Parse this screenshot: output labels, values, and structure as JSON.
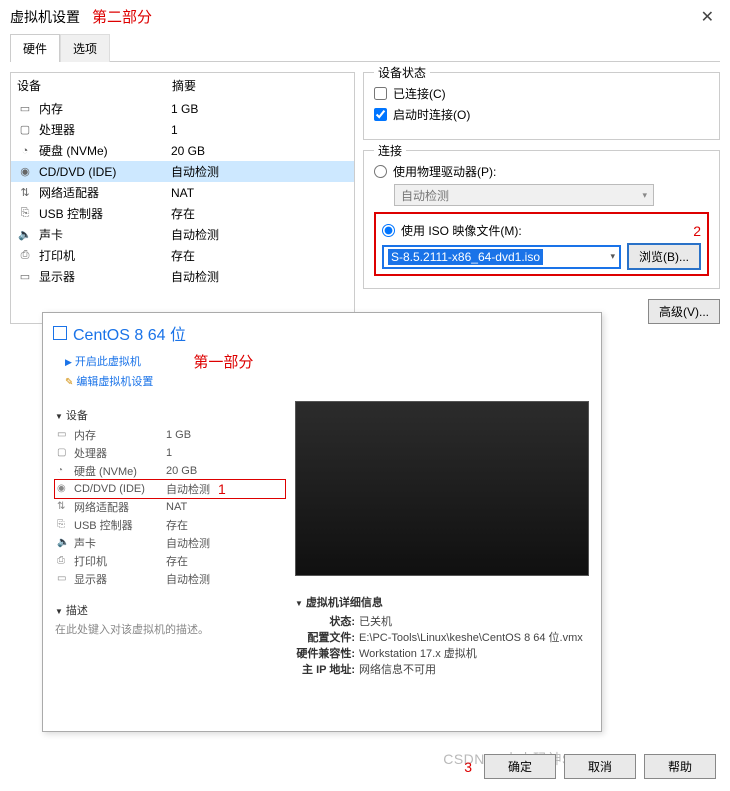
{
  "title": "虚拟机设置",
  "annotations": {
    "part2": "第二部分",
    "part1": "第一部分",
    "mark1": "1",
    "mark2": "2",
    "mark3": "3"
  },
  "close": "✕",
  "tabs": {
    "hardware": "硬件",
    "options": "选项"
  },
  "hw_header": {
    "device": "设备",
    "summary": "摘要"
  },
  "hw": [
    {
      "icon": "▭",
      "name": "内存",
      "summary": "1 GB"
    },
    {
      "icon": "▢",
      "name": "处理器",
      "summary": "1"
    },
    {
      "icon": "◔",
      "name": "硬盘 (NVMe)",
      "summary": "20 GB"
    },
    {
      "icon": "◉",
      "name": "CD/DVD (IDE)",
      "summary": "自动检测"
    },
    {
      "icon": "⇅",
      "name": "网络适配器",
      "summary": "NAT"
    },
    {
      "icon": "⎘",
      "name": "USB 控制器",
      "summary": "存在"
    },
    {
      "icon": "🔈",
      "name": "声卡",
      "summary": "自动检测"
    },
    {
      "icon": "⎙",
      "name": "打印机",
      "summary": "存在"
    },
    {
      "icon": "▭",
      "name": "显示器",
      "summary": "自动检测"
    }
  ],
  "status_group": {
    "title": "设备状态",
    "connected": "已连接(C)",
    "connect_on_power": "启动时连接(O)"
  },
  "conn_group": {
    "title": "连接",
    "use_physical": "使用物理驱动器(P):",
    "auto_detect": "自动检测",
    "use_iso": "使用 ISO 映像文件(M):",
    "iso_value": "S-8.5.2111-x86_64-dvd1.iso",
    "browse": "浏览(B)...",
    "advanced": "高级(V)..."
  },
  "inner": {
    "title": "CentOS 8 64 位",
    "open": "开启此虚拟机",
    "edit": "编辑虚拟机设置",
    "devices_title": "设备",
    "devices": [
      {
        "icon": "▭",
        "name": "内存",
        "summary": "1 GB"
      },
      {
        "icon": "▢",
        "name": "处理器",
        "summary": "1"
      },
      {
        "icon": "◔",
        "name": "硬盘 (NVMe)",
        "summary": "20 GB"
      },
      {
        "icon": "◉",
        "name": "CD/DVD (IDE)",
        "summary": "自动检测"
      },
      {
        "icon": "⇅",
        "name": "网络适配器",
        "summary": "NAT"
      },
      {
        "icon": "⎘",
        "name": "USB 控制器",
        "summary": "存在"
      },
      {
        "icon": "🔈",
        "name": "声卡",
        "summary": "自动检测"
      },
      {
        "icon": "⎙",
        "name": "打印机",
        "summary": "存在"
      },
      {
        "icon": "▭",
        "name": "显示器",
        "summary": "自动检测"
      }
    ],
    "desc_title": "描述",
    "desc_text": "在此处键入对该虚拟机的描述。",
    "detail_title": "虚拟机详细信息",
    "details": {
      "state_k": "状态:",
      "state_v": "已关机",
      "cfg_k": "配置文件:",
      "cfg_v": "E:\\PC-Tools\\Linux\\keshe\\CentOS 8 64 位.vmx",
      "compat_k": "硬件兼容性:",
      "compat_v": "Workstation 17.x 虚拟机",
      "ip_k": "主 IP 地址:",
      "ip_v": "网络信息不可用"
    }
  },
  "footer": {
    "ok": "确定",
    "cancel": "取消",
    "help": "帮助"
  },
  "watermark": "CSDN @小小码神Sundayx"
}
